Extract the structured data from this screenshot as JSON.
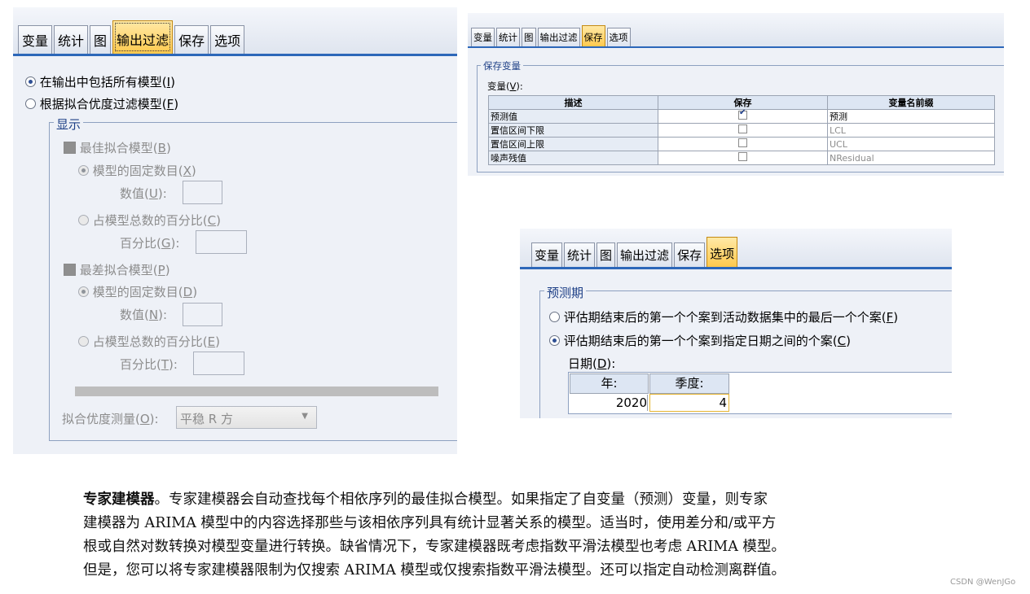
{
  "tabs": [
    "变量",
    "统计",
    "图",
    "输出过滤",
    "保存",
    "选项"
  ],
  "panel1": {
    "radio_include_all": "在输出中包括所有模型(",
    "radio_include_all_key": "I",
    "radio_filter": "根据拟合优度过滤模型(",
    "radio_filter_key": "F",
    "display_legend": "显示",
    "best_fit": "最佳拟合模型(",
    "best_fit_key": "B",
    "fixed_count_1": "模型的固定数目(",
    "fixed_count_1_key": "X",
    "value_1": "数值(",
    "value_1_key": "U",
    "percent_1": "占模型总数的百分比(",
    "percent_1_key": "C",
    "pct_1": "百分比(",
    "pct_1_key": "G",
    "worst_fit": "最差拟合模型(",
    "worst_fit_key": "P",
    "fixed_count_2": "模型的固定数目(",
    "fixed_count_2_key": "D",
    "value_2": "数值(",
    "value_2_key": "N",
    "percent_2": "占模型总数的百分比(",
    "percent_2_key": "E",
    "pct_2": "百分比(",
    "pct_2_key": "T",
    "goodness_label": "拟合优度测量(",
    "goodness_key": "O",
    "goodness_value": "平稳 R 方"
  },
  "panel2": {
    "legend": "保存变量",
    "variables_label": "变量(",
    "variables_key": "V",
    "headers": [
      "描述",
      "保存",
      "变量名前缀"
    ],
    "rows": [
      {
        "desc": "预测值",
        "saved": true,
        "prefix": "预测"
      },
      {
        "desc": "置信区间下限",
        "saved": false,
        "prefix": "LCL"
      },
      {
        "desc": "置信区间上限",
        "saved": false,
        "prefix": "UCL"
      },
      {
        "desc": "噪声残值",
        "saved": false,
        "prefix": "NResidual"
      }
    ]
  },
  "panel3": {
    "legend": "预测期",
    "radio_1": "评估期结束后的第一个个案到活动数据集中的最后一个个案(",
    "radio_1_key": "F",
    "radio_2": "评估期结束后的第一个个案到指定日期之间的个案(",
    "radio_2_key": "C",
    "date_label": "日期(",
    "date_key": "D",
    "col_year": "年:",
    "col_quarter": "季度:",
    "year_value": "2020",
    "quarter_value": "4"
  },
  "paragraph": {
    "title": "专家建模器",
    "line1": "。专家建模器会自动查找每个相依序列的最佳拟合模型。如果指定了自变量（预测）变量，则专家",
    "line2": "建模器为 ARIMA 模型中的内容选择那些与该相依序列具有统计显著关系的模型。适当时，使用差分和/或平方",
    "line3": "根或自然对数转换对模型变量进行转换。缺省情况下，专家建模器既考虑指数平滑法模型也考虑 ARIMA 模型。",
    "line4": "但是，您可以将专家建模器限制为仅搜索 ARIMA 模型或仅搜索指数平滑法模型。还可以指定自动检测离群值。"
  },
  "watermark": "CSDN @WenJGo"
}
